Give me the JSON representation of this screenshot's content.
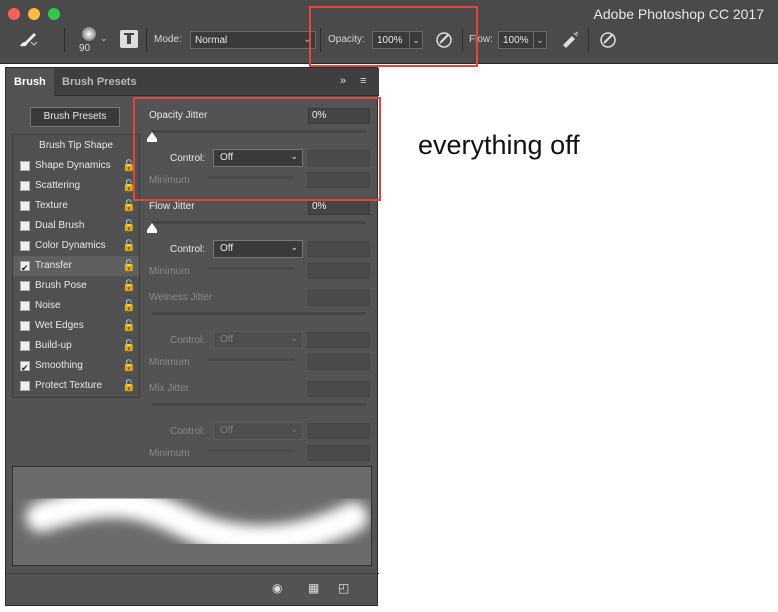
{
  "app": {
    "title": "Adobe Photoshop CC 2017"
  },
  "options_bar": {
    "brush_size": "90",
    "mode_label": "Mode:",
    "mode_value": "Normal",
    "opacity_label": "Opacity:",
    "opacity_value": "100%",
    "flow_label": "Flow:",
    "flow_value": "100%"
  },
  "panel": {
    "tabs": [
      "Brush",
      "Brush Presets"
    ],
    "brush_presets_button": "Brush Presets",
    "brush_tip_shape": "Brush Tip Shape",
    "items": [
      {
        "label": "Shape Dynamics",
        "checked": false
      },
      {
        "label": "Scattering",
        "checked": false
      },
      {
        "label": "Texture",
        "checked": false
      },
      {
        "label": "Dual Brush",
        "checked": false
      },
      {
        "label": "Color Dynamics",
        "checked": false
      },
      {
        "label": "Transfer",
        "checked": true
      },
      {
        "label": "Brush Pose",
        "checked": false
      },
      {
        "label": "Noise",
        "checked": false
      },
      {
        "label": "Wet Edges",
        "checked": false
      },
      {
        "label": "Build-up",
        "checked": false
      },
      {
        "label": "Smoothing",
        "checked": true
      },
      {
        "label": "Protect Texture",
        "checked": false
      }
    ],
    "sections": [
      {
        "title": "Opacity Jitter",
        "value": "0%",
        "control_label": "Control:",
        "control_value": "Off",
        "minimum_label": "Minimum",
        "enabled": true
      },
      {
        "title": "Flow Jitter",
        "value": "0%",
        "control_label": "Control:",
        "control_value": "Off",
        "minimum_label": "Minimum",
        "enabled": true
      },
      {
        "title": "Wetness Jitter",
        "value": "",
        "control_label": "Control:",
        "control_value": "Off",
        "minimum_label": "Minimum",
        "enabled": false
      },
      {
        "title": "Mix Jitter",
        "value": "",
        "control_label": "Control:",
        "control_value": "Off",
        "minimum_label": "Minimum",
        "enabled": false
      }
    ]
  },
  "annotation": {
    "text": "everything off",
    "highlight_color": "#e0473a"
  }
}
